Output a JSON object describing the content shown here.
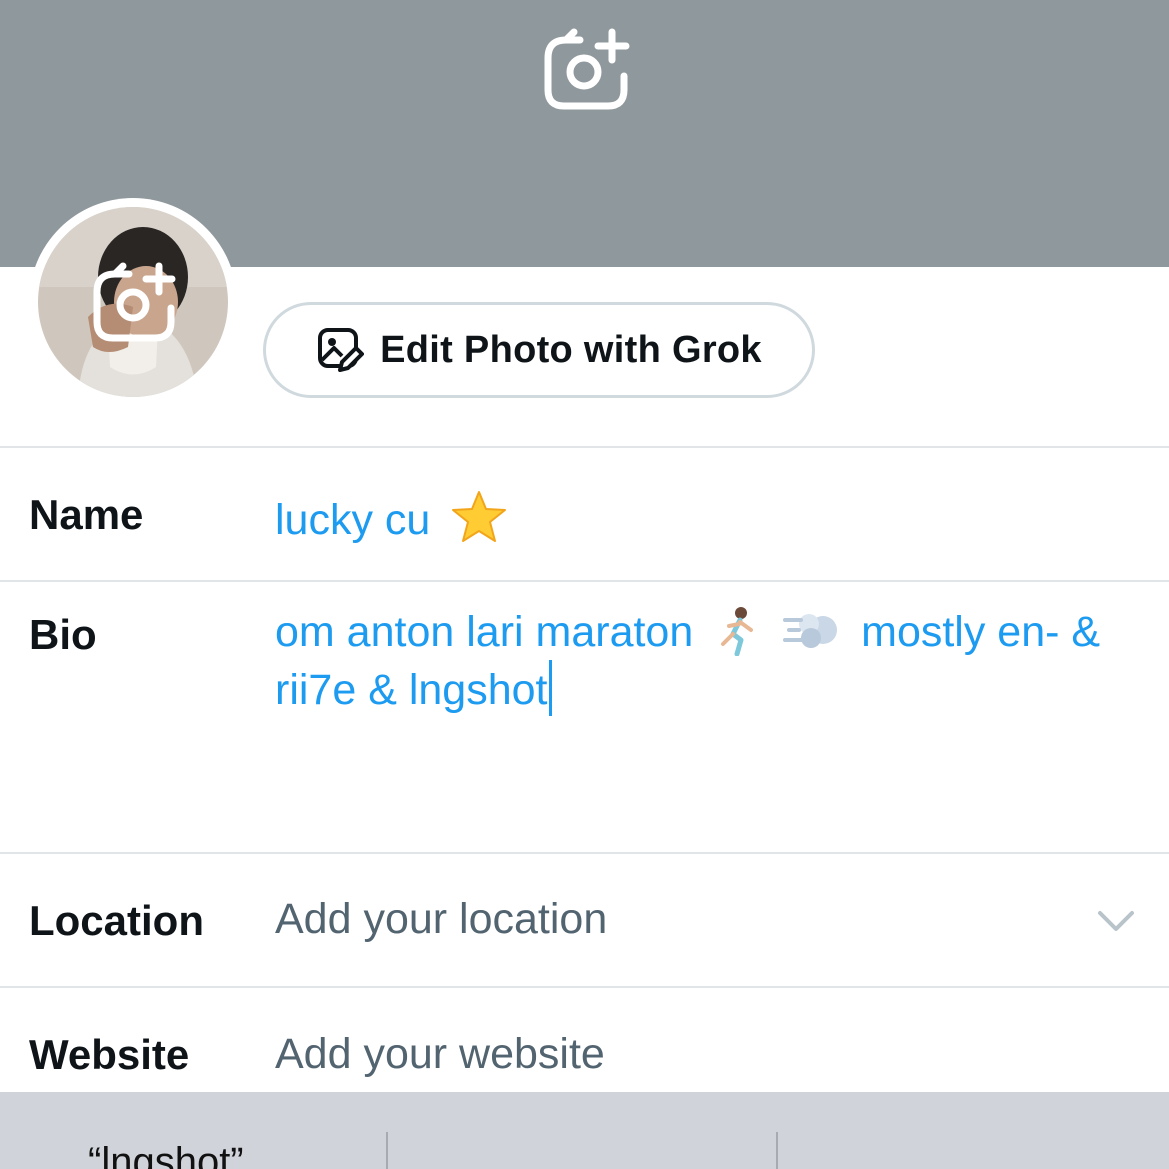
{
  "header": {
    "banner_color": "#8f989c",
    "banner_icon": "camera-plus-icon",
    "avatar_icon": "camera-plus-icon"
  },
  "edit_photo_button": {
    "label": "Edit Photo with Grok",
    "icon": "image-edit-icon"
  },
  "fields": {
    "name": {
      "label": "Name",
      "value": "lucky cu",
      "emoji": "star-emoji"
    },
    "bio": {
      "label": "Bio",
      "line1_text": "om anton lari maraton",
      "line1_text_after": "mostly en- &",
      "line2_text": "rii7e & lngshot",
      "emojis": [
        "woman-running-emoji",
        "dash-emoji"
      ]
    },
    "location": {
      "label": "Location",
      "placeholder": "Add your location",
      "icon": "chevron-down-icon"
    },
    "website": {
      "label": "Website",
      "placeholder": "Add your website"
    }
  },
  "keyboard": {
    "suggestions": [
      "“lngshot”",
      "",
      ""
    ]
  },
  "colors": {
    "accent": "#1d9bf0",
    "text_primary": "#0f1419",
    "text_secondary": "#536471",
    "divider": "#e1e5e8"
  }
}
